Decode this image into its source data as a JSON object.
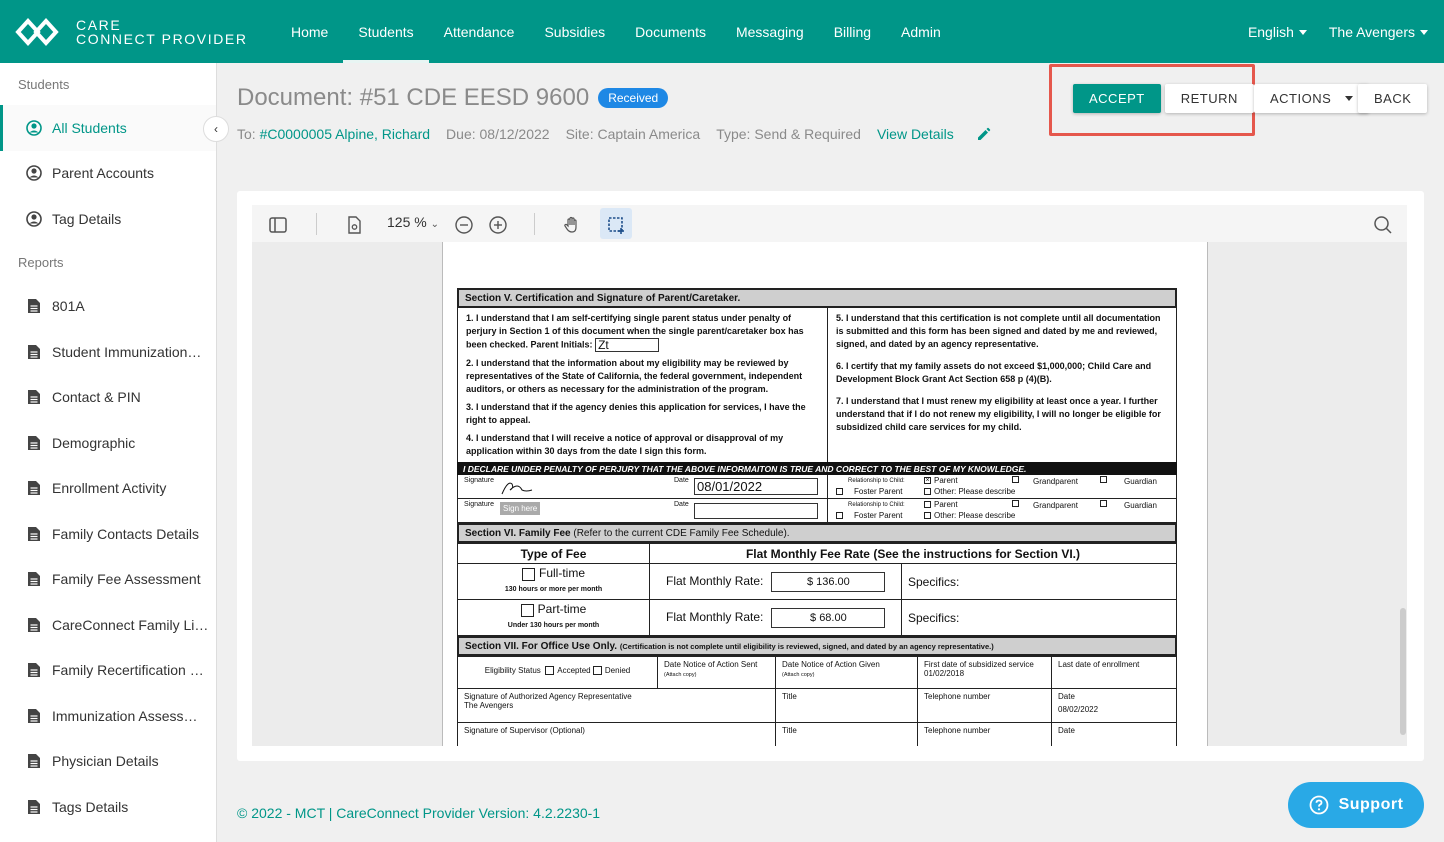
{
  "brand": {
    "line1": "CARE",
    "line2": "CONNECT PROVIDER"
  },
  "nav": {
    "items": [
      {
        "label": "Home"
      },
      {
        "label": "Students"
      },
      {
        "label": "Attendance"
      },
      {
        "label": "Subsidies"
      },
      {
        "label": "Documents"
      },
      {
        "label": "Messaging"
      },
      {
        "label": "Billing"
      },
      {
        "label": "Admin"
      }
    ],
    "language": "English",
    "org": "The Avengers"
  },
  "sidebar": {
    "students_heading": "Students",
    "student_items": [
      {
        "label": "All Students"
      },
      {
        "label": "Parent Accounts"
      },
      {
        "label": "Tag Details"
      }
    ],
    "reports_heading": "Reports",
    "report_items": [
      {
        "label": "801A"
      },
      {
        "label": "Student Immunization…"
      },
      {
        "label": "Contact & PIN"
      },
      {
        "label": "Demographic"
      },
      {
        "label": "Enrollment Activity"
      },
      {
        "label": "Family Contacts Details"
      },
      {
        "label": "Family Fee Assessment"
      },
      {
        "label": "CareConnect Family Li…"
      },
      {
        "label": "Family Recertification …"
      },
      {
        "label": "Immunization Assess…"
      },
      {
        "label": "Physician Details"
      },
      {
        "label": "Tags Details"
      }
    ]
  },
  "document": {
    "title": "Document: #51 CDE EESD 9600",
    "status": "Received",
    "to_label": "To:",
    "to_value": "#C0000005 Alpine, Richard",
    "due": "Due: 08/12/2022",
    "site": "Site: Captain America",
    "type": "Type: Send & Required",
    "view_details": "View Details"
  },
  "actions": {
    "accept": "ACCEPT",
    "return": "RETURN",
    "actions": "ACTIONS",
    "back": "BACK"
  },
  "viewer": {
    "zoom": "125 %"
  },
  "form": {
    "sec5_title": "Section V.  Certification and Signature of Parent/Caretaker.",
    "left_p1a": "1. I understand that I am self-certifying single parent status under penalty of perjury in Section 1 of this document when the single parent/caretaker box has been checked.   Parent Initials:",
    "parent_initials": "Zt",
    "left_p2": "2. I understand that the information about my eligibility may be reviewed by representatives of the State of California, the federal government, independent auditors, or others as necessary for the administration of the program.",
    "left_p3": "3. I understand that if the agency denies this application for services, I have the right to appeal.",
    "left_p4": "4. I understand that I will receive a notice of approval or disapproval of my application within 30 days from the date I sign this form.",
    "right_p5": "5. I understand that this certification is not complete until all documentation is submitted and this form has been signed and dated by me and reviewed, signed, and dated by an agency representative.",
    "right_p6": "6. I certify that my family assets do not exceed $1,000,000; Child Care and Development Block Grant Act Section 658 p (4)(B).",
    "right_p7": "7. I understand that I must renew my eligibility at least once a year. I further understand that if I do not renew my eligibility, I will no longer be eligible for subsidized child care services for my child.",
    "declare": "I DECLARE UNDER PENALTY OF PERJURY THAT THE ABOVE INFORMAITON IS TRUE AND CORRECT TO THE BEST OF MY KNOWLEDGE.",
    "sig_label": "Signature",
    "date_label": "Date",
    "sig_date": "08/01/2022",
    "sign_here": "Sign here",
    "rel_label": "Relationship to Child:",
    "rel_parent": "Parent",
    "rel_grandparent": "Grandparent",
    "rel_guardian": "Guardian",
    "rel_foster": "Foster Parent",
    "rel_other": "Other: Please describe",
    "sec6_title": "Section VI.  Family Fee",
    "sec6_note": "(Refer to the current CDE Family Fee Schedule).",
    "type_of_fee": "Type of Fee",
    "flat_rate_header": "Flat Monthly Fee Rate (See the instructions for Section VI.)",
    "fulltime": "Full-time",
    "fulltime_note": "130 hours or more per month",
    "parttime": "Part-time",
    "parttime_note": "Under 130 hours per month",
    "flat_rate_label": "Flat Monthly Rate:",
    "fulltime_rate": "$ 136.00",
    "parttime_rate": "$ 68.00",
    "specifics": "Specifics:",
    "sec7_title": "Section VII.  For Office Use Only.",
    "sec7_note": "(Certification is not complete until eligibility is reviewed, signed, and dated by an agency representative.)",
    "elig_status": "Eligibility Status",
    "accepted": "Accepted",
    "denied": "Denied",
    "notice_sent": "Date Notice of Action Sent",
    "notice_given": "Date Notice of Action Given",
    "attach_copy": "(Attach copy)",
    "first_date": "First date of subsidized service",
    "first_date_value": "01/02/2018",
    "last_date": "Last date of enrollment",
    "auth_sig": "Signature of Authorized Agency Representative",
    "auth_name": "The Avengers",
    "title_label": "Title",
    "phone_label": "Telephone number",
    "auth_date": "08/02/2022",
    "supervisor_sig": "Signature of Supervisor (Optional)"
  },
  "footer": {
    "text": "© 2022 - MCT | CareConnect Provider Version: 4.2.2230-1"
  },
  "support": {
    "label": "Support"
  },
  "colors": {
    "primary": "#009688",
    "badge": "#1e88e5",
    "highlight": "#e5574c",
    "support": "#29a9e6"
  }
}
